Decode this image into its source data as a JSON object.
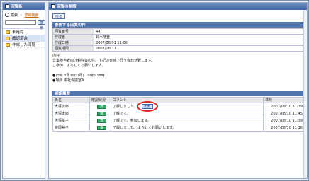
{
  "left": {
    "title": "回覧板",
    "search_label": "検索",
    "advanced_search": "詳細検索",
    "search_placeholder": "",
    "search_button": "検索",
    "tree": [
      {
        "label": "未確認",
        "active": false
      },
      {
        "label": "確認済み",
        "active": true
      },
      {
        "label": "作成した回覧",
        "active": false
      }
    ]
  },
  "main": {
    "title": "回覧の参照",
    "back_button": "戻る",
    "details_title": "参照する回覧の件",
    "details": [
      {
        "key": "回覧番号",
        "value": "44"
      },
      {
        "key": "作成者",
        "value": "鈴木茂登"
      },
      {
        "key": "作成日時",
        "value": "2007/08/01 11:06"
      },
      {
        "key": "回覧期限",
        "value": "2007/08/17"
      }
    ],
    "content_label": "内容",
    "content_lines": [
      "営業担当者向け勉強会の件、下記の日時で行う会わせ致します。",
      "ご参加、よろしくお願いします。",
      "",
      "●日時 8月30日(月) 15時～18時",
      "●場所 本社会議室A"
    ],
    "history_title": "確認履歴",
    "history_headers": {
      "name": "氏名",
      "status": "確認状況",
      "comment": "コメント",
      "date": "日時"
    },
    "history": [
      {
        "name": "大塚次郎",
        "status": "済",
        "comment": "了解しました。",
        "date": "2007/08/10 11:39",
        "change": "変更"
      },
      {
        "name": "大塚太郎",
        "status": "済",
        "comment": "了解です。",
        "date": "2007/08/10 11:45",
        "change": ""
      },
      {
        "name": "大塚花子",
        "status": "済",
        "comment": "了解です。参加します。",
        "date": "2007/08/10 11:39",
        "change": ""
      },
      {
        "name": "竜尾裕子",
        "status": "済",
        "comment": "了解しました。よろしくお願いします。",
        "date": "2007/08/10 11:16",
        "change": ""
      }
    ]
  }
}
